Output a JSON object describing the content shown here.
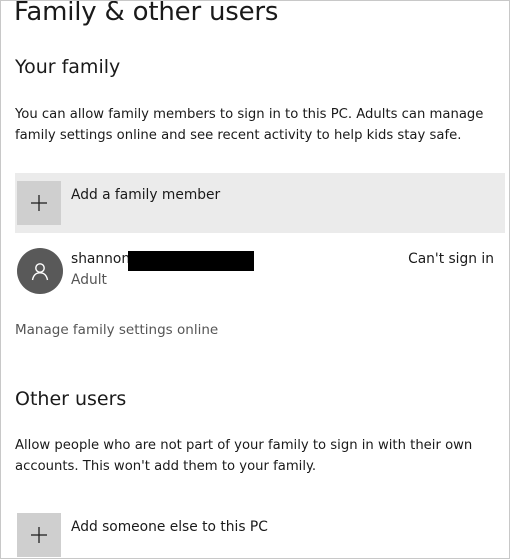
{
  "page": {
    "title": "Family & other users"
  },
  "family": {
    "heading": "Your family",
    "description": "You can allow family members to sign in to this PC. Adults can manage family settings online and see recent activity to help kids stay safe.",
    "add_label": "Add a family member",
    "add_icon": "plus-icon",
    "member": {
      "name": "shannon",
      "role": "Adult",
      "status": "Can't sign in",
      "avatar_icon": "person-icon"
    },
    "manage_link": "Manage family settings online"
  },
  "other_users": {
    "heading": "Other users",
    "description": "Allow people who are not part of your family to sign in with their own accounts. This won't add them to your family.",
    "add_label": "Add someone else to this PC",
    "add_icon": "plus-icon"
  },
  "colors": {
    "highlight_row": "#ebebeb",
    "plus_tile": "#cfcfcf",
    "avatar": "#595959"
  }
}
